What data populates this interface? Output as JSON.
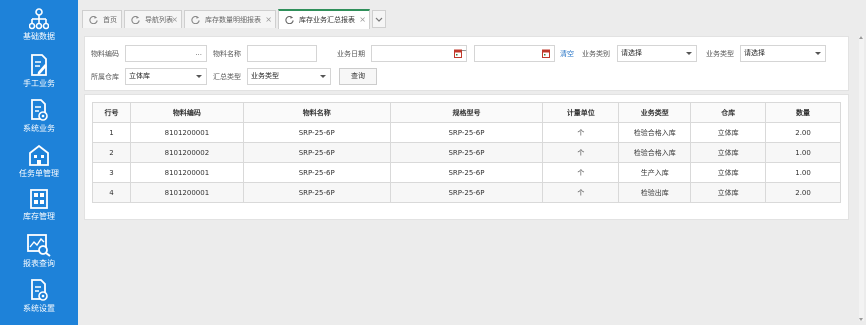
{
  "sidebar": {
    "items": [
      {
        "label": "基础数据",
        "icon": "hierarchy-icon"
      },
      {
        "label": "手工业务",
        "icon": "edit-document-icon"
      },
      {
        "label": "系统业务",
        "icon": "document-gear-icon"
      },
      {
        "label": "任务单管理",
        "icon": "building-icon"
      },
      {
        "label": "库存管理",
        "icon": "grid-icon"
      },
      {
        "label": "报表查询",
        "icon": "chart-search-icon"
      },
      {
        "label": "系统设置",
        "icon": "document-gear-icon"
      }
    ]
  },
  "tabs": [
    {
      "label": "首页",
      "closable": false
    },
    {
      "label": "导航列表",
      "closable": true
    },
    {
      "label": "库存数量明细报表",
      "closable": true
    },
    {
      "label": "库存业务汇总报表",
      "closable": true,
      "active": true
    }
  ],
  "filters": {
    "material_code_label": "物料编码",
    "material_code_value": "",
    "material_code_dots": "...",
    "material_name_label": "物料名称",
    "material_name_value": "",
    "biz_date_label": "业务日期",
    "biz_date_from": "",
    "date_separator": "~",
    "biz_date_to": "",
    "clear_label": "清空",
    "biz_category_label": "业务类别",
    "biz_category_value": "请选择",
    "biz_type_label": "业务类型",
    "biz_type_value": "请选择",
    "warehouse_label": "所属仓库",
    "warehouse_value": "立体库",
    "summary_type_label": "汇总类型",
    "summary_type_value": "业务类型",
    "query_label": "查询"
  },
  "table": {
    "headers": [
      "行号",
      "物料编码",
      "物料名称",
      "规格型号",
      "计量单位",
      "业务类型",
      "仓库",
      "数量"
    ],
    "rows": [
      [
        "1",
        "8101200001",
        "SRP-25-6P",
        "SRP-25-6P",
        "个",
        "检验合格入库",
        "立体库",
        "2.00"
      ],
      [
        "2",
        "8101200002",
        "SRP-25-6P",
        "SRP-25-6P",
        "个",
        "检验合格入库",
        "立体库",
        "1.00"
      ],
      [
        "3",
        "8101200001",
        "SRP-25-6P",
        "SRP-25-6P",
        "个",
        "生产入库",
        "立体库",
        "1.00"
      ],
      [
        "4",
        "8101200001",
        "SRP-25-6P",
        "SRP-25-6P",
        "个",
        "检验出库",
        "立体库",
        "2.00"
      ]
    ]
  },
  "colors": {
    "sidebar": "#1e82d9",
    "active_tab_accent": "#2f8f5a",
    "link": "#1e6fc4"
  }
}
